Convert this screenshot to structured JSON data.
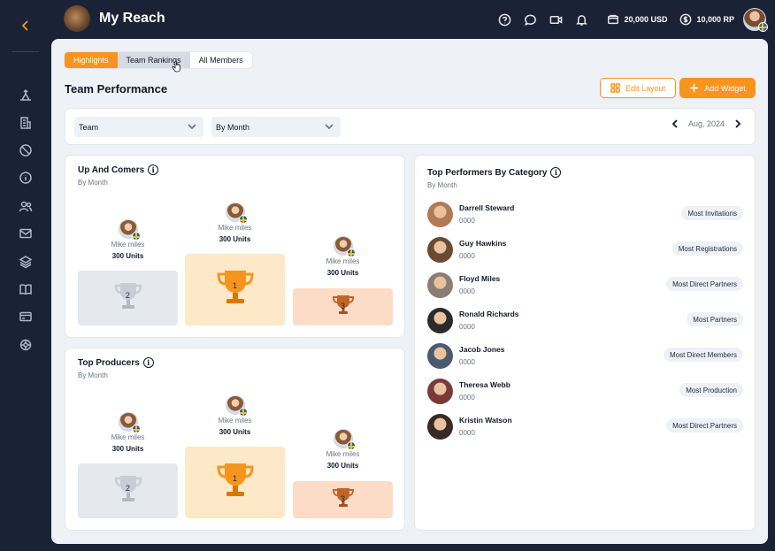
{
  "app": {
    "title": "My Reach"
  },
  "topbar": {
    "usd_balance": "20,000 USD",
    "rp_balance": "10,000 RP"
  },
  "tabs": [
    {
      "label": "Highlights"
    },
    {
      "label": "Team Rankings"
    },
    {
      "label": "All Members"
    }
  ],
  "page": {
    "title": "Team Performance"
  },
  "actions": {
    "edit_layout": "Edit Layout",
    "add_widget": "Add Widget"
  },
  "filters": {
    "team": "Team",
    "period": "By Month",
    "date": "Aug, 2024"
  },
  "up_and_comers": {
    "title": "Up And Comers",
    "subtitle": "By Month",
    "ranks": [
      {
        "rank": "1",
        "name": "Mike miles",
        "units": "300 Units"
      },
      {
        "rank": "2",
        "name": "Mike miles",
        "units": "300 Units"
      },
      {
        "rank": "3",
        "name": "Mike miles",
        "units": "300 Units"
      }
    ]
  },
  "top_producers": {
    "title": "Top Producers",
    "subtitle": "By Month",
    "ranks": [
      {
        "rank": "1",
        "name": "Mike miles",
        "units": "300 Units"
      },
      {
        "rank": "2",
        "name": "Mike miles",
        "units": "300 Units"
      },
      {
        "rank": "3",
        "name": "Mike miles",
        "units": "300 Units"
      }
    ]
  },
  "top_performers": {
    "title": "Top Performers By Category",
    "subtitle": "By Month",
    "rows": [
      {
        "name": "Darrell Steward",
        "value": "0000",
        "category": "Most Invitations",
        "avatar_color": "#b07a55"
      },
      {
        "name": "Guy Hawkins",
        "value": "0000",
        "category": "Most Registrations",
        "avatar_color": "#6b4a34"
      },
      {
        "name": "Floyd Miles",
        "value": "0000",
        "category": "Most Direct Partners",
        "avatar_color": "#8a7d74"
      },
      {
        "name": "Ronald Richards",
        "value": "0000",
        "category": "Most Partners",
        "avatar_color": "#2b2b2b"
      },
      {
        "name": "Jacob Jones",
        "value": "0000",
        "category": "Most Direct Members",
        "avatar_color": "#4a5a70"
      },
      {
        "name": "Theresa Webb",
        "value": "0000",
        "category": "Most Production",
        "avatar_color": "#7a3a3a"
      },
      {
        "name": "Kristin Watson",
        "value": "0000",
        "category": "Most Direct Partners",
        "avatar_color": "#3a2a26"
      }
    ]
  },
  "colors": {
    "accent": "#f7941d",
    "sidebar_bg": "#1a2236",
    "panel_bg": "#eef1f6"
  }
}
